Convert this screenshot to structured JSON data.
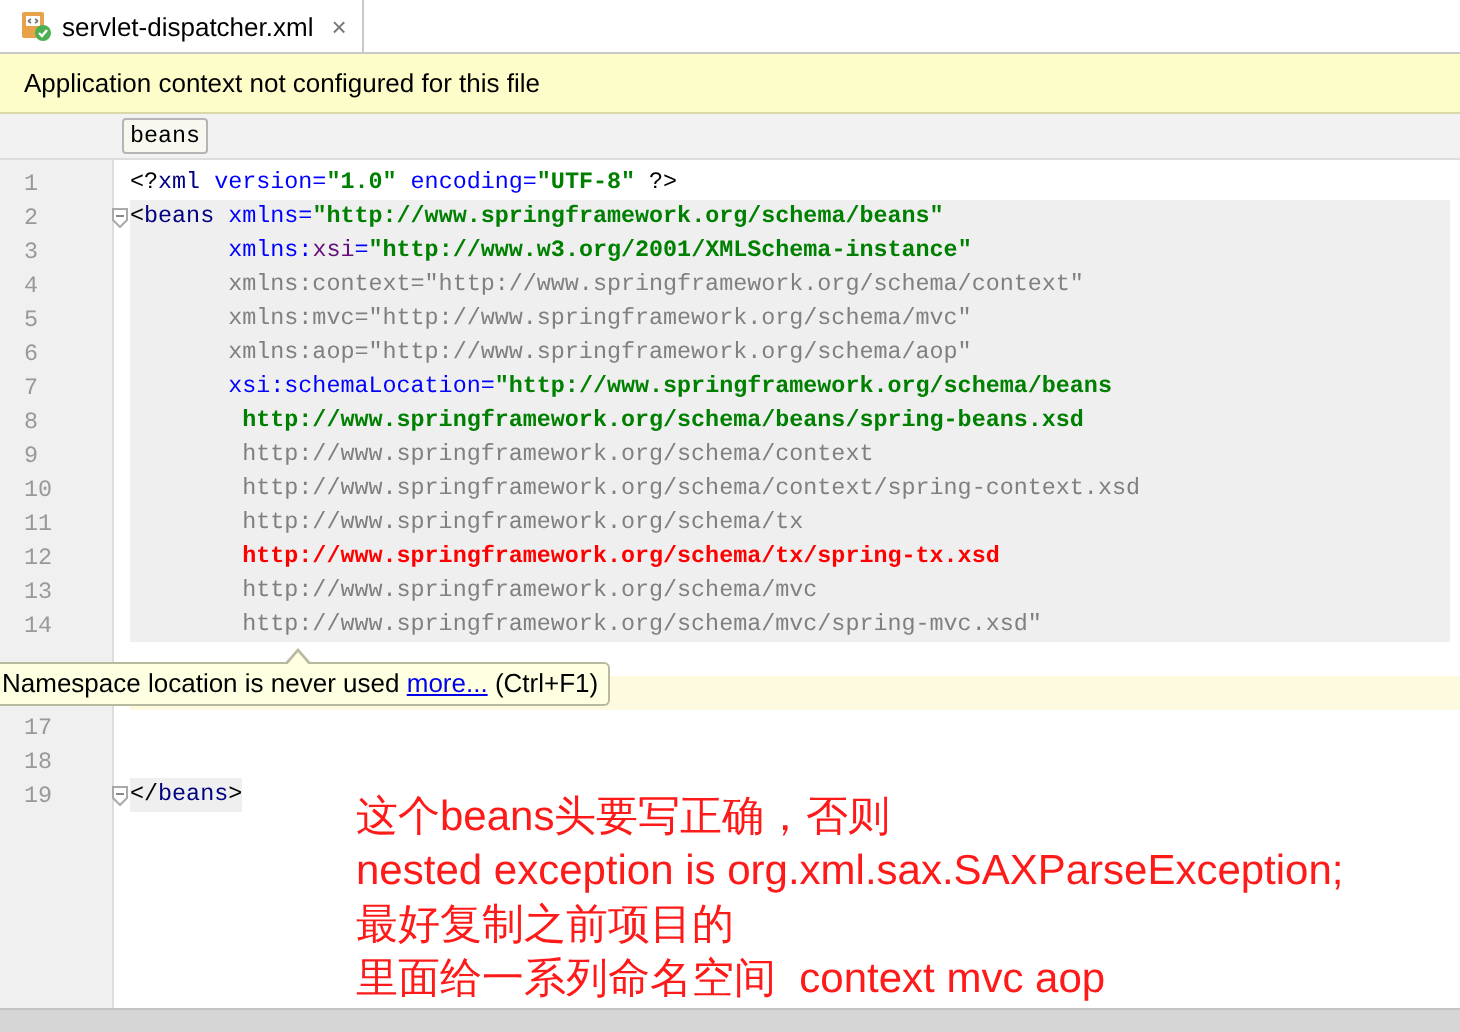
{
  "tab": {
    "title": "servlet-dispatcher.xml",
    "close": "×",
    "selected": true
  },
  "banner": {
    "text": "Application context not configured for this file"
  },
  "breadcrumb": [
    {
      "label": "beans"
    }
  ],
  "lines": [
    {
      "number": "1",
      "kind": "plain",
      "fold": false,
      "segments": [
        {
          "kind": "bracket",
          "t": "<?"
        },
        {
          "kind": "tag",
          "t": "xml"
        },
        {
          "kind": "attr",
          "t": " version="
        },
        {
          "kind": "value",
          "t": "\"1.0\""
        },
        {
          "kind": "attr",
          "t": " encoding="
        },
        {
          "kind": "value",
          "t": "\"UTF-8\""
        },
        {
          "kind": "bracket",
          "t": " ?>"
        }
      ]
    },
    {
      "number": "2",
      "kind": "block",
      "fold": true,
      "segments": [
        {
          "kind": "bracket",
          "t": "<"
        },
        {
          "kind": "tag",
          "t": "beans"
        },
        {
          "kind": "attr",
          "t": " xmlns="
        },
        {
          "kind": "value",
          "t": "\"http://www.springframework.org/schema/beans\""
        }
      ]
    },
    {
      "number": "3",
      "kind": "block",
      "fold": false,
      "segments": [
        {
          "kind": "attr",
          "t": "       xmlns:"
        },
        {
          "kind": "ns",
          "t": "xsi"
        },
        {
          "kind": "attr",
          "t": "="
        },
        {
          "kind": "value",
          "t": "\"http://www.w3.org/2001/XMLSchema-instance\""
        }
      ]
    },
    {
      "number": "4",
      "kind": "block",
      "fold": false,
      "segments": [
        {
          "kind": "unused",
          "t": "       xmlns:context=\"http://www.springframework.org/schema/context\""
        }
      ]
    },
    {
      "number": "5",
      "kind": "block",
      "fold": false,
      "segments": [
        {
          "kind": "unused",
          "t": "       xmlns:mvc=\"http://www.springframework.org/schema/mvc\""
        }
      ]
    },
    {
      "number": "6",
      "kind": "block",
      "fold": false,
      "segments": [
        {
          "kind": "unused",
          "t": "       xmlns:aop=\"http://www.springframework.org/schema/aop\""
        }
      ]
    },
    {
      "number": "7",
      "kind": "block",
      "fold": false,
      "segments": [
        {
          "kind": "attr",
          "t": "       xsi:schemaLocation="
        },
        {
          "kind": "value",
          "t": "\"http://www.springframework.org/schema/beans"
        }
      ]
    },
    {
      "number": "8",
      "kind": "block",
      "fold": false,
      "segments": [
        {
          "kind": "value",
          "t": "        http://www.springframework.org/schema/beans/spring-beans.xsd"
        }
      ]
    },
    {
      "number": "9",
      "kind": "block",
      "fold": false,
      "segments": [
        {
          "kind": "unused",
          "t": "        http://www.springframework.org/schema/context"
        }
      ]
    },
    {
      "number": "10",
      "kind": "block",
      "fold": false,
      "segments": [
        {
          "kind": "unused",
          "t": "        http://www.springframework.org/schema/context/spring-context.xsd"
        }
      ]
    },
    {
      "number": "11",
      "kind": "block",
      "fold": false,
      "segments": [
        {
          "kind": "unused",
          "t": "        http://www.springframework.org/schema/tx"
        }
      ]
    },
    {
      "number": "12",
      "kind": "block",
      "fold": false,
      "segments": [
        {
          "kind": "error",
          "t": "        http://www.springframework.org/schema/tx/spring-tx.xsd"
        }
      ]
    },
    {
      "number": "13",
      "kind": "block",
      "fold": false,
      "segments": [
        {
          "kind": "unused",
          "t": "        http://www.springframework.org/schema/mvc"
        }
      ]
    },
    {
      "number": "14",
      "kind": "block",
      "fold": false,
      "segments": [
        {
          "kind": "unused",
          "t": "        http://www.springframework.org/schema/mvc/spring-mvc.xsd\""
        }
      ]
    },
    {
      "kind": "plain",
      "fold": false
    },
    {
      "kind": "current",
      "fold": false
    },
    {
      "number": "17",
      "kind": "plain",
      "fold": false
    },
    {
      "number": "18",
      "kind": "plain",
      "fold": false
    },
    {
      "number": "19",
      "kind": "tag",
      "fold": true,
      "segments": [
        {
          "kind": "bracket",
          "t": "</"
        },
        {
          "kind": "tag",
          "t": "beans"
        },
        {
          "kind": "bracket",
          "t": ">"
        }
      ]
    }
  ],
  "tooltip": {
    "text": "Namespace location is never used",
    "link": "more...",
    "shortcut": "(Ctrl+F1)"
  },
  "annotation": [
    "这个beans头要写正确，否则",
    "nested exception is org.xml.sax.SAXParseException;",
    "最好复制之前项目的",
    "里面给一系列命名空间  context mvc aop"
  ]
}
